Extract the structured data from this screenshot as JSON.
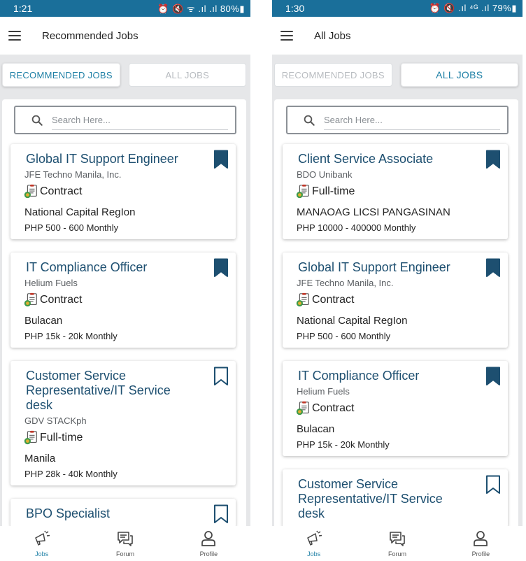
{
  "left": {
    "status": {
      "time": "1:21",
      "indicators": "⏰ 🔇 ᯤ .ıl .ıl 80%▮"
    },
    "header_title": "Recommended Jobs",
    "tabs": {
      "recommended": "RECOMMENDED JOBS",
      "all": "ALL JOBS",
      "active": "recommended"
    },
    "search_placeholder": "Search Here...",
    "jobs": [
      {
        "title": "Global IT Support Engineer",
        "company": "JFE Techno Manila, Inc.",
        "type": "Contract",
        "location": "National Capital RegIon",
        "salary": "PHP 500 - 600 Monthly",
        "bookmarked": true
      },
      {
        "title": "IT Compliance Officer",
        "company": "Helium Fuels",
        "type": "Contract",
        "location": "Bulacan",
        "salary": "PHP 15k - 20k Monthly",
        "bookmarked": true
      },
      {
        "title": "Customer Service Representative/IT Service desk",
        "company": "GDV STACKph",
        "type": "Full-time",
        "location": "Manila",
        "salary": "PHP 28k - 40k Monthly",
        "bookmarked": false
      },
      {
        "title": "BPO Specialist",
        "company": "",
        "type": "",
        "location": "",
        "salary": "",
        "bookmarked": false
      }
    ]
  },
  "right": {
    "status": {
      "time": "1:30",
      "indicators": "⏰ 🔇 .ıl ⁴ᴳ .ıl 79%▮"
    },
    "header_title": "All Jobs",
    "tabs": {
      "recommended": "RECOMMENDED JOBS",
      "all": "ALL JOBS",
      "active": "all"
    },
    "search_placeholder": "Search Here...",
    "jobs": [
      {
        "title": "Client Service Associate",
        "company": "BDO Unibank",
        "type": "Full-time",
        "location": "MANAOAG LICSI PANGASINAN",
        "salary": "PHP 10000 - 400000 Monthly",
        "bookmarked": true
      },
      {
        "title": "Global IT Support Engineer",
        "company": "JFE Techno Manila, Inc.",
        "type": "Contract",
        "location": "National Capital RegIon",
        "salary": "PHP 500 - 600 Monthly",
        "bookmarked": true
      },
      {
        "title": "IT Compliance Officer",
        "company": "Helium Fuels",
        "type": "Contract",
        "location": "Bulacan",
        "salary": "PHP 15k - 20k Monthly",
        "bookmarked": true
      },
      {
        "title": "Customer Service Representative/IT Service desk",
        "company": "",
        "type": "",
        "location": "",
        "salary": "",
        "bookmarked": false
      }
    ]
  },
  "bottom_nav": {
    "items": [
      {
        "label": "Jobs",
        "icon": "megaphone-icon",
        "active": true
      },
      {
        "label": "Forum",
        "icon": "chat-bubbles-icon",
        "active": false
      },
      {
        "label": "Profile",
        "icon": "person-icon",
        "active": false
      }
    ]
  },
  "colors": {
    "status_bar": "#1a6f9a",
    "accent": "#1f80a6",
    "job_title": "#1d4f70",
    "bookmark": "#1d4f70"
  }
}
